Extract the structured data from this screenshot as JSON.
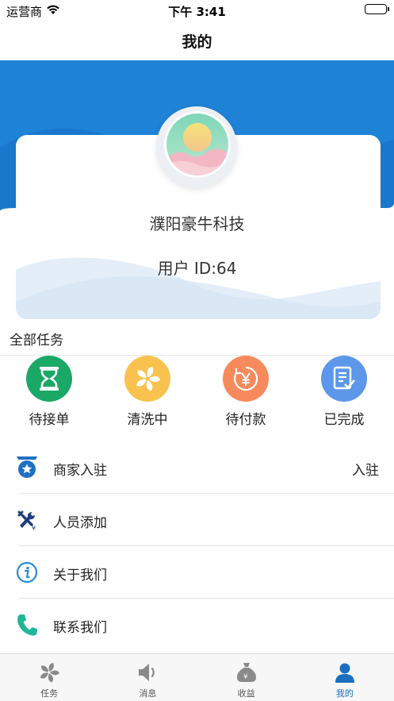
{
  "status_bar": {
    "carrier": "运营商",
    "time": "下午 3:41"
  },
  "nav": {
    "title": "我的"
  },
  "profile": {
    "company": "濮阳豪牛科技",
    "user_id": "用户 ID:64"
  },
  "tasks": {
    "title": "全部任务",
    "items": [
      {
        "label": "待接单",
        "icon": "hourglass-icon",
        "color": "#1aa866"
      },
      {
        "label": "清洗中",
        "icon": "fan-icon",
        "color": "#f9c24f"
      },
      {
        "label": "待付款",
        "icon": "yen-icon",
        "color": "#f78a5c"
      },
      {
        "label": "已完成",
        "icon": "document-check-icon",
        "color": "#5d97ea"
      }
    ]
  },
  "menu": {
    "items": [
      {
        "label": "商家入驻",
        "right": "入驻",
        "icon": "merchant-badge-icon"
      },
      {
        "label": "人员添加",
        "right": "",
        "icon": "tools-icon"
      },
      {
        "label": "关于我们",
        "right": "",
        "icon": "info-icon"
      },
      {
        "label": "联系我们",
        "right": "",
        "icon": "phone-icon"
      }
    ]
  },
  "tab_bar": {
    "tabs": [
      {
        "label": "任务",
        "icon": "fan-icon"
      },
      {
        "label": "消息",
        "icon": "speaker-icon"
      },
      {
        "label": "收益",
        "icon": "money-bag-icon"
      },
      {
        "label": "我的",
        "icon": "person-icon",
        "active": true
      }
    ]
  },
  "colors": {
    "header_blue": "#1a78cc",
    "active_tab": "#1a6fbe"
  }
}
